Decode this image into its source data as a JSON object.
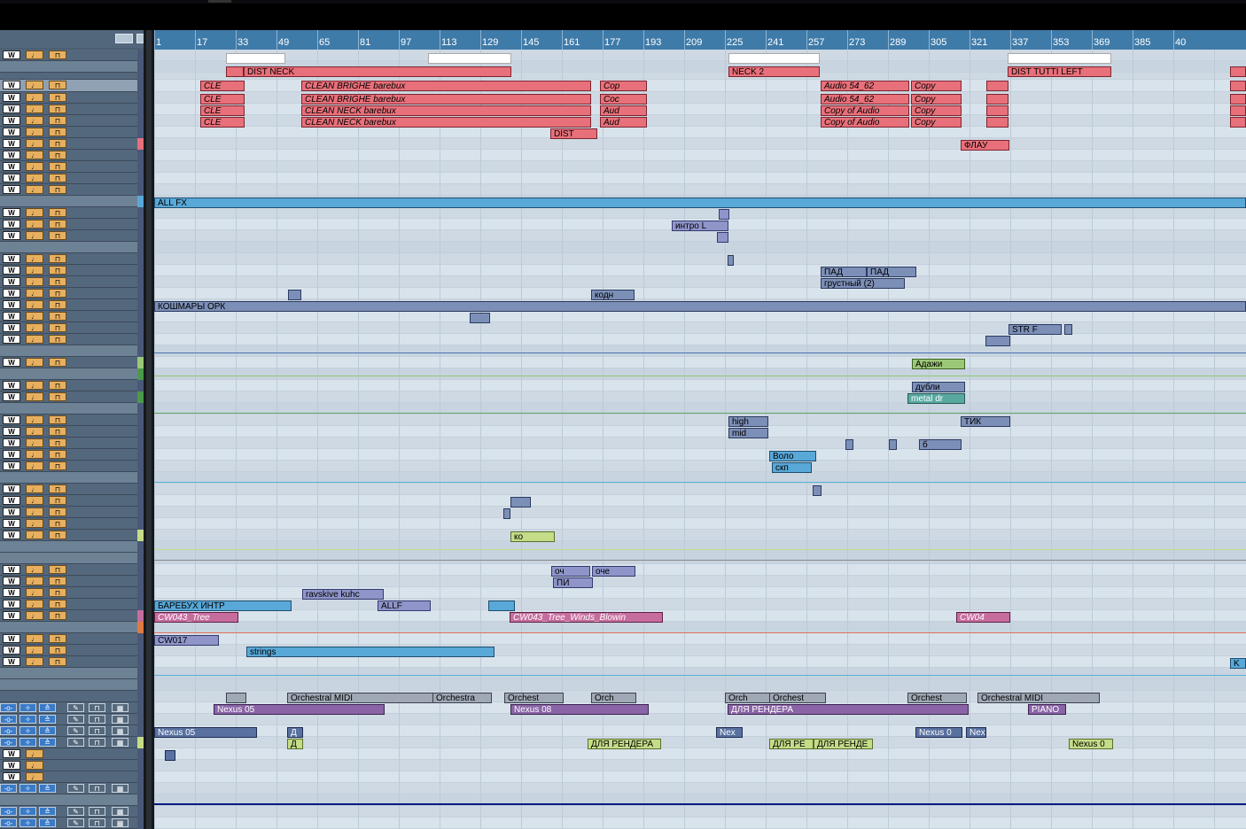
{
  "ruler": {
    "ticks": [
      "1",
      "17",
      "33",
      "49",
      "65",
      "81",
      "97",
      "113",
      "129",
      "145",
      "161",
      "177",
      "193",
      "209",
      "225",
      "241",
      "257",
      "273",
      "289",
      "305",
      "321",
      "337",
      "353",
      "369",
      "385",
      "40"
    ]
  },
  "colors": {
    "ruler_bg": "#3f7ba9",
    "arrange_bg": "#d9e3ec",
    "track_panel_bg": "#4d5f73",
    "red_clip": "#e8707a",
    "blue_clip": "#58a8d8"
  },
  "track_buttons": {
    "write": "W",
    "note_icon": "note-icon",
    "lock_icon": "lock-icon"
  },
  "clips": [
    {
      "label": "DIST NECK",
      "style": "c-red"
    },
    {
      "label": "NECK 2",
      "style": "c-red"
    },
    {
      "label": "DIST TUTTI LEFT",
      "style": "c-red"
    },
    {
      "label": "CLE",
      "style": "c-red it"
    },
    {
      "label": "CLEAN BRIGHE barebux",
      "style": "c-red it"
    },
    {
      "label": "Cop",
      "style": "c-red it"
    },
    {
      "label": "Audio 54_62",
      "style": "c-red it"
    },
    {
      "label": "Copy",
      "style": "c-red it"
    },
    {
      "label": "CLE",
      "style": "c-red it"
    },
    {
      "label": "CLEAN BRIGHE barebux",
      "style": "c-red it"
    },
    {
      "label": "Coc",
      "style": "c-red it"
    },
    {
      "label": "Audio 54_62",
      "style": "c-red it"
    },
    {
      "label": "Copy",
      "style": "c-red it"
    },
    {
      "label": "CLE",
      "style": "c-red it"
    },
    {
      "label": "CLEAN NECK barebux",
      "style": "c-red it"
    },
    {
      "label": "Aud",
      "style": "c-red it"
    },
    {
      "label": "Copy of Audio",
      "style": "c-red it"
    },
    {
      "label": "Copy",
      "style": "c-red it"
    },
    {
      "label": "CLE",
      "style": "c-red it"
    },
    {
      "label": "CLEAN NECK barebux",
      "style": "c-red it"
    },
    {
      "label": "Aud",
      "style": "c-red it"
    },
    {
      "label": "Copy of Audio",
      "style": "c-red it"
    },
    {
      "label": "Copy",
      "style": "c-red it"
    },
    {
      "label": "DIST",
      "style": "c-red"
    },
    {
      "label": "ФЛАУ",
      "style": "c-red"
    },
    {
      "label": "ALL FX",
      "style": "c-blue"
    },
    {
      "label": "интро L",
      "style": "c-lav"
    },
    {
      "label": "ПАД",
      "style": "c-slate it"
    },
    {
      "label": "ПАД",
      "style": "c-slate it"
    },
    {
      "label": "грустный (2)",
      "style": "c-slate"
    },
    {
      "label": "кодн",
      "style": "c-slate"
    },
    {
      "label": "КОШМАРЫ ОРК",
      "style": "c-slate"
    },
    {
      "label": "STR F",
      "style": "c-slate"
    },
    {
      "label": "Адажи",
      "style": "c-green"
    },
    {
      "label": "дубли",
      "style": "c-slate"
    },
    {
      "label": "metal dr",
      "style": "c-teal"
    },
    {
      "label": "high",
      "style": "c-slate"
    },
    {
      "label": "mid",
      "style": "c-slate"
    },
    {
      "label": "ТИК",
      "style": "c-slate"
    },
    {
      "label": "Воло",
      "style": "c-blue"
    },
    {
      "label": "скп",
      "style": "c-blue"
    },
    {
      "label": "б",
      "style": "c-slate"
    },
    {
      "label": "ко",
      "style": "c-lime"
    },
    {
      "label": "оч",
      "style": "c-lav"
    },
    {
      "label": "оче",
      "style": "c-lav"
    },
    {
      "label": "ПИ",
      "style": "c-lav"
    },
    {
      "label": "ravskive kuhc",
      "style": "c-lav"
    },
    {
      "label": "БАРЕБУХ ИНТР",
      "style": "c-blue"
    },
    {
      "label": "ALLF",
      "style": "c-lav it"
    },
    {
      "label": "CW043_Tree",
      "style": "c-pink"
    },
    {
      "label": "CW043_Tree_Winds_Blowin",
      "style": "c-pink"
    },
    {
      "label": "CW04",
      "style": "c-pink"
    },
    {
      "label": "CW017",
      "style": "c-lav"
    },
    {
      "label": "strings",
      "style": "c-blue"
    },
    {
      "label": "K",
      "style": "c-blue"
    },
    {
      "label": "Orchestral MIDI",
      "style": "c-grey"
    },
    {
      "label": "Orchestra",
      "style": "c-grey"
    },
    {
      "label": "Orchest",
      "style": "c-grey"
    },
    {
      "label": "Orch",
      "style": "c-grey"
    },
    {
      "label": "Orch",
      "style": "c-grey"
    },
    {
      "label": "Orchest",
      "style": "c-grey"
    },
    {
      "label": "Orchest",
      "style": "c-grey"
    },
    {
      "label": "Orchestral MIDI",
      "style": "c-grey"
    },
    {
      "label": "Nexus 05",
      "style": "c-purple"
    },
    {
      "label": "Nexus 08",
      "style": "c-purple"
    },
    {
      "label": "ДЛЯ РЕНДЕРА",
      "style": "c-purple"
    },
    {
      "label": "PIANO",
      "style": "c-purple"
    },
    {
      "label": "Nexus 05",
      "style": "c-navy"
    },
    {
      "label": "Д",
      "style": "c-navy"
    },
    {
      "label": "Nex",
      "style": "c-navy"
    },
    {
      "label": "Nexus 0",
      "style": "c-navy"
    },
    {
      "label": "Nex",
      "style": "c-navy"
    },
    {
      "label": "Д",
      "style": "c-lime"
    },
    {
      "label": "ДЛЯ РЕНДЕРА",
      "style": "c-lime"
    },
    {
      "label": "ДЛЯ РЕ",
      "style": "c-lime"
    },
    {
      "label": "ДЛЯ РЕНДЕ",
      "style": "c-lime"
    },
    {
      "label": "Nexus 0",
      "style": "c-lime"
    }
  ]
}
